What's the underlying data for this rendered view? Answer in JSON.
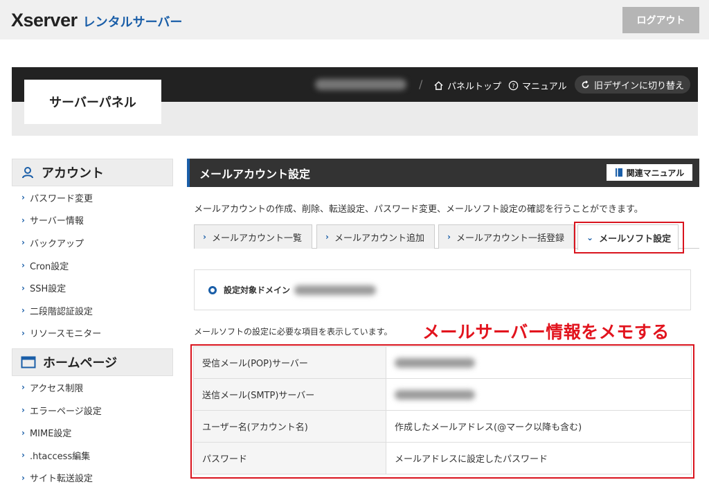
{
  "header": {
    "logo_brand": "Xserver",
    "logo_product": "レンタルサーバー",
    "logout_label": "ログアウト"
  },
  "panel": {
    "title": "サーバーパネル",
    "nav": [
      {
        "label": "パネルトップ",
        "icon": "home-icon"
      },
      {
        "label": "マニュアル",
        "icon": "help-circle-icon"
      }
    ],
    "old_design_label": "旧デザインに切り替え"
  },
  "sidebar": {
    "sections": [
      {
        "title": "アカウント",
        "icon": "user-icon",
        "items": [
          "パスワード変更",
          "サーバー情報",
          "バックアップ",
          "Cron設定",
          "SSH設定",
          "二段階認証設定",
          "リソースモニター"
        ]
      },
      {
        "title": "ホームページ",
        "icon": "window-icon",
        "items": [
          "アクセス制限",
          "エラーページ設定",
          "MIME設定",
          ".htaccess編集",
          "サイト転送設定"
        ]
      }
    ]
  },
  "main": {
    "title": "メールアカウント設定",
    "manual_label": "関連マニュアル",
    "description": "メールアカウントの作成、削除、転送設定、パスワード変更、メールソフト設定の確認を行うことができます。",
    "tabs": [
      {
        "label": "メールアカウント一覧",
        "active": false
      },
      {
        "label": "メールアカウント追加",
        "active": false
      },
      {
        "label": "メールアカウント一括登録",
        "active": false
      },
      {
        "label": "メールソフト設定",
        "active": true
      }
    ],
    "domain_label": "設定対象ドメイン",
    "note": "メールソフトの設定に必要な項目を表示しています。",
    "annotation": "メールサーバー情報をメモする",
    "rows": [
      {
        "key": "受信メール(POP)サーバー",
        "value": ""
      },
      {
        "key": "送信メール(SMTP)サーバー",
        "value": ""
      },
      {
        "key": "ユーザー名(アカウント名)",
        "value": "作成したメールアドレス(@マーク以降も含む)"
      },
      {
        "key": "パスワード",
        "value": "メールアドレスに設定したパスワード"
      }
    ]
  },
  "colors": {
    "accent": "#1a5ea8",
    "highlight": "#d9131d",
    "dark_bar": "#222222"
  }
}
